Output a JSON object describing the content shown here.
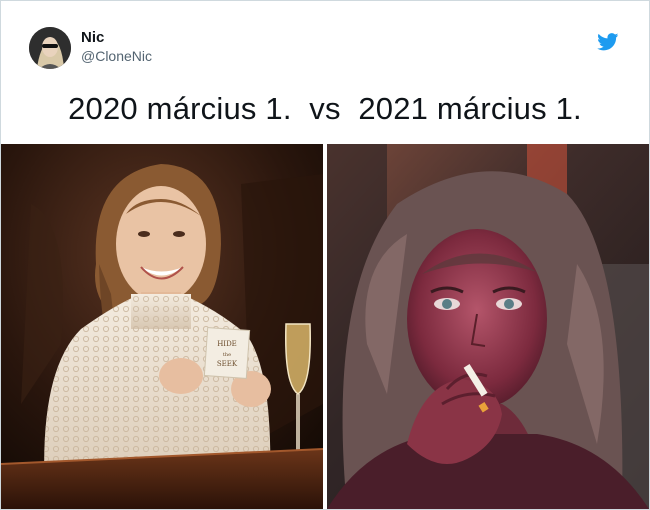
{
  "tweet": {
    "author": {
      "display_name": "Nic",
      "handle": "@CloneNic",
      "avatar_icon": "profile-avatar"
    },
    "platform_icon": "twitter-bird-icon",
    "brand_color": "#1d9bf0",
    "text": "2020 március 1.  vs  2021 március 1."
  },
  "media": {
    "left_image": {
      "card_text": [
        "HIDE",
        "the",
        "SEEK"
      ]
    },
    "right_image": {}
  }
}
